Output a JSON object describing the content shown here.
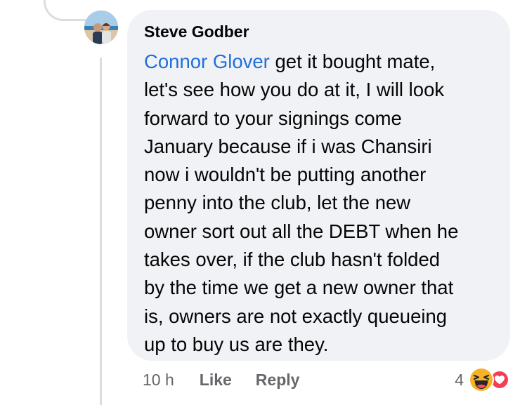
{
  "comment": {
    "author": "Steve Godber",
    "mention": "Connor Glover",
    "lines": [
      " get it bought mate,",
      "let's see how you do at it, I will look",
      "forward to your signings come",
      "January because if i was Chansiri",
      "now i wouldn't be putting another",
      "penny into the club, let the new",
      "owner sort out all the DEBT when he",
      "takes over, if the club hasn't folded",
      "by the time we get a new owner that",
      "is, owners are not exactly queueing",
      "up to buy us are they."
    ]
  },
  "actions": {
    "time": "10 h",
    "like_label": "Like",
    "reply_label": "Reply"
  },
  "reactions": {
    "count": "4",
    "icons": [
      "haha-reaction-icon",
      "love-reaction-icon"
    ]
  },
  "colors": {
    "bubble": "#f0f2f5",
    "mention": "#216fdb",
    "text": "#050505",
    "meta": "#65676b",
    "thread_line": "#dadde1",
    "love": "#f33e58",
    "haha": "#f7b125"
  }
}
